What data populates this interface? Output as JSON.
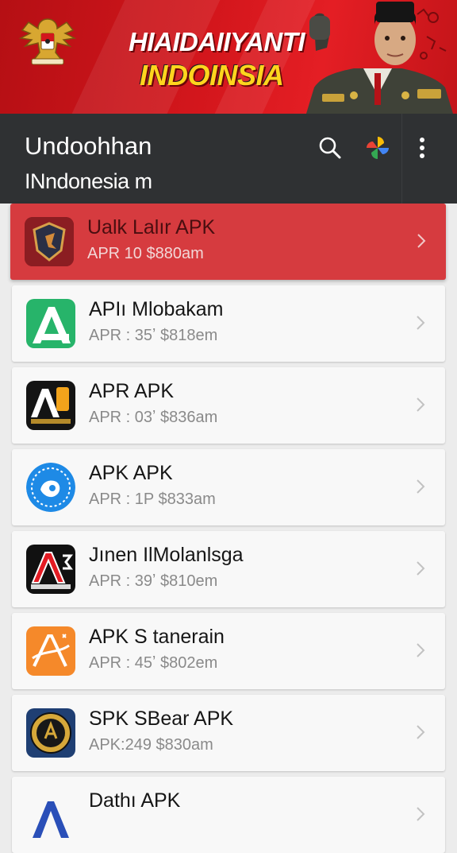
{
  "banner": {
    "line1": "HIAIDAIIYANTI",
    "line2": "INDOINSIA"
  },
  "appbar": {
    "title": "Undoohhan",
    "subtitle": "INndonesia m",
    "actions": [
      "search-icon",
      "pinwheel-icon",
      "more-vert-icon"
    ]
  },
  "colors": {
    "banner_red": "#d3161c",
    "banner_yellow": "#ffd51e",
    "appbar_bg": "#2f3133",
    "active_item": "#d63b3f",
    "card_bg": "#f8f8f8"
  },
  "apps": [
    {
      "name": "Ualk Lalır APK",
      "meta": "APR 10  $880am"
    },
    {
      "name": "APIı Mlobakam",
      "meta": "APR : 35ʼ  $818em"
    },
    {
      "name": "APR APK",
      "meta": "APR : 03ʼ  $836am"
    },
    {
      "name": "APK APK",
      "meta": "APR : 1P  $833am"
    },
    {
      "name": "Jınen IlMolanlsga",
      "meta": "APR : 39ʼ  $810em"
    },
    {
      "name": "APK S tanerain",
      "meta": "APR : 45ʼ  $802em"
    },
    {
      "name": "SPK SBear APK",
      "meta": "APK:249  $830am"
    },
    {
      "name": "Dathı APK",
      "meta": ""
    }
  ]
}
